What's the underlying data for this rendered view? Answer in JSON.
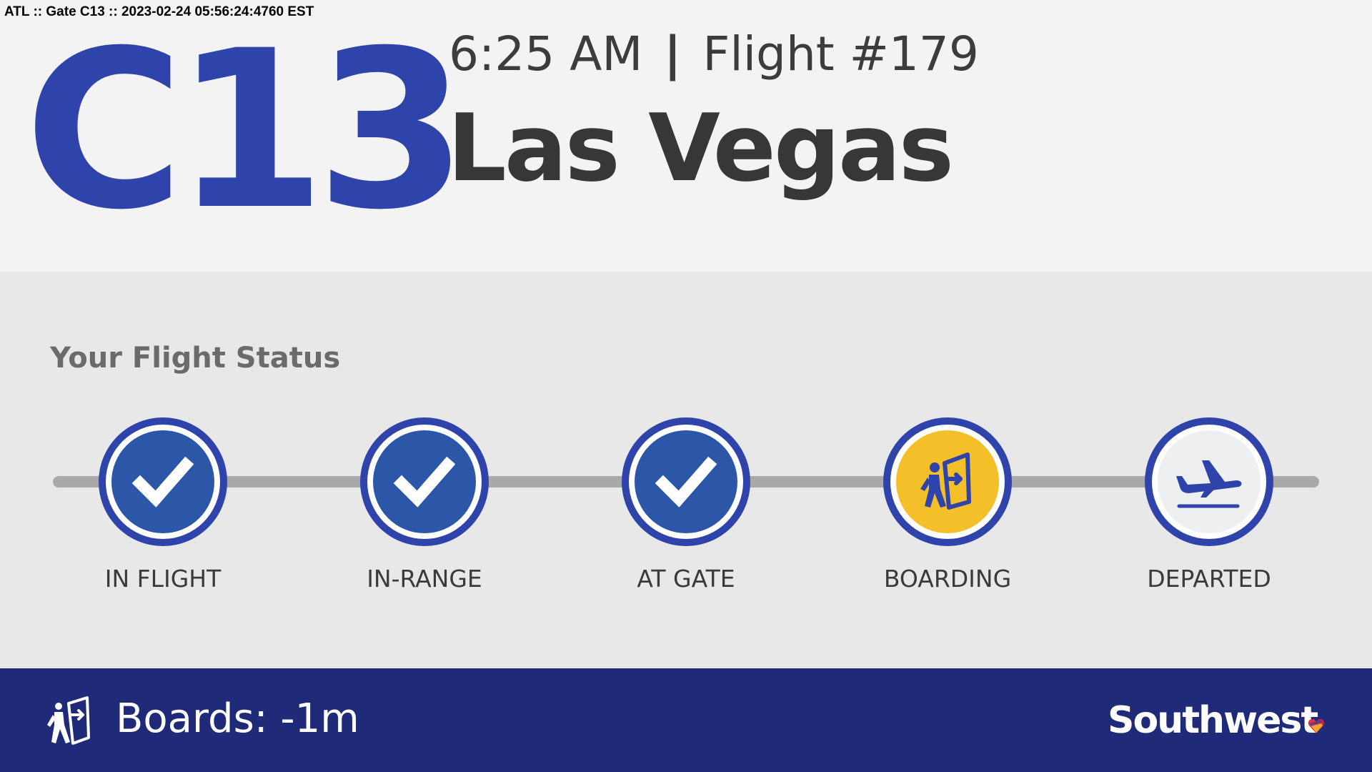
{
  "debug_line": "ATL :: Gate C13 :: 2023-02-24 05:56:24:4760 EST",
  "gate": "C13",
  "time": "6:25 AM",
  "separator": "|",
  "flight": "Flight #179",
  "destination": "Las Vegas",
  "status_title": "Your Flight Status",
  "steps": [
    {
      "label": "IN FLIGHT",
      "state": "complete",
      "icon": "check-icon"
    },
    {
      "label": "IN-RANGE",
      "state": "complete",
      "icon": "check-icon"
    },
    {
      "label": "AT GATE",
      "state": "complete",
      "icon": "check-icon"
    },
    {
      "label": "BOARDING",
      "state": "current",
      "icon": "boarding-door-icon"
    },
    {
      "label": "DEPARTED",
      "state": "upcoming",
      "icon": "departing-plane-icon"
    }
  ],
  "footer": {
    "boards_text": "Boards: -1m",
    "icon": "boarding-door-icon",
    "brand": "Southwest",
    "brand_mark": "heart-logo-icon"
  },
  "colors": {
    "gate_blue": "#2f44ab",
    "complete_blue": "#2c57a8",
    "current_yellow": "#f5bf2a",
    "footer_navy": "#1f2a78",
    "track_gray": "#a9a9a9"
  }
}
